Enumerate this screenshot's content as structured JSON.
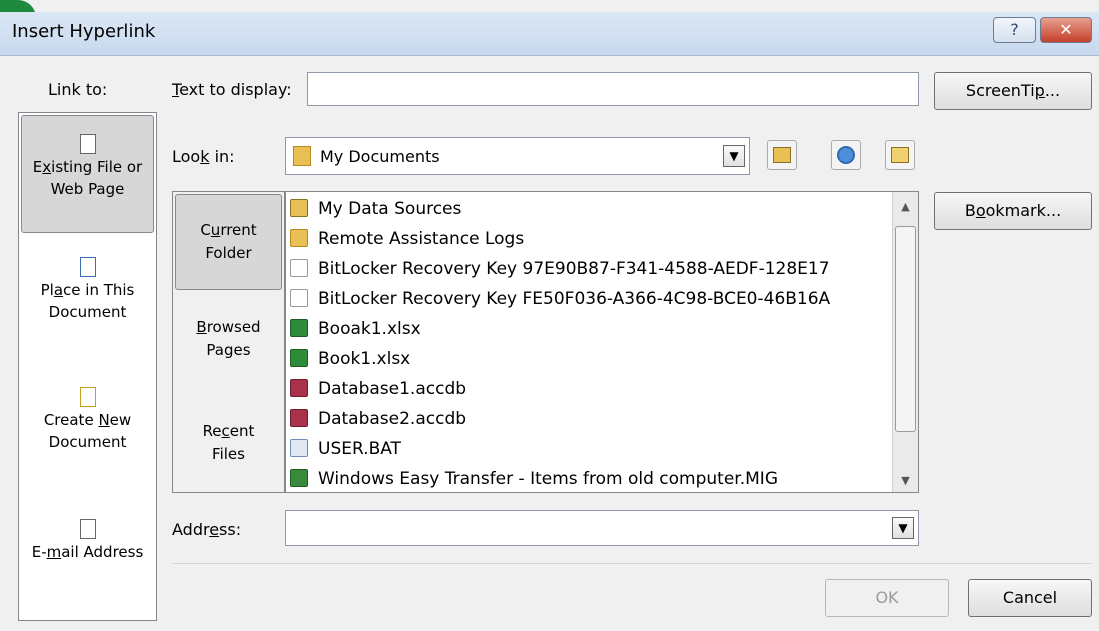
{
  "window": {
    "title": "Insert Hyperlink",
    "help_label": "?",
    "close_label": "✕"
  },
  "link_to": {
    "header": "Link to:",
    "items": [
      {
        "label_pre": "E",
        "label_u": "x",
        "label_post": "isting File or",
        "line2": "Web Page",
        "icon": "existing-file-icon"
      },
      {
        "label_pre": "Pl",
        "label_u": "a",
        "label_post": "ce in This",
        "line2": "Document",
        "icon": "place-in-document-icon"
      },
      {
        "label_pre": "Create ",
        "label_u": "N",
        "label_post": "ew",
        "line2": "Document",
        "icon": "create-new-document-icon"
      },
      {
        "label_pre": "E-",
        "label_u": "m",
        "label_post": "ail Address",
        "line2": "",
        "icon": "email-address-icon"
      }
    ]
  },
  "text_to_display": {
    "label_u": "T",
    "label_rest": "ext to display:",
    "value": ""
  },
  "screentip_button": {
    "pre": "ScreenTi",
    "u": "p",
    "post": "..."
  },
  "look_in": {
    "label_pre": "Loo",
    "label_u": "k",
    "label_post": " in:",
    "value": "My Documents"
  },
  "folder_nav": [
    {
      "line1_pre": "C",
      "line1_u": "u",
      "line1_post": "rrent",
      "line2": "Folder"
    },
    {
      "line1_pre": "",
      "line1_u": "B",
      "line1_post": "rowsed",
      "line2": "Pages"
    },
    {
      "line1_pre": "Re",
      "line1_u": "c",
      "line1_post": "ent",
      "line2": "Files"
    }
  ],
  "files": [
    {
      "name": "My Data Sources",
      "icon": "data-sources-folder-icon",
      "color": "#e8c056"
    },
    {
      "name": "Remote Assistance Logs",
      "icon": "folder-icon",
      "color": "#e8c056"
    },
    {
      "name": "BitLocker Recovery Key 97E90B87-F341-4588-AEDF-128E17",
      "icon": "text-file-icon",
      "color": "#ffffff"
    },
    {
      "name": "BitLocker Recovery Key FE50F036-A366-4C98-BCE0-46B16A",
      "icon": "text-file-icon",
      "color": "#ffffff"
    },
    {
      "name": "Booak1.xlsx",
      "icon": "excel-file-icon",
      "color": "#2e8b3a"
    },
    {
      "name": "Book1.xlsx",
      "icon": "excel-file-icon",
      "color": "#2e8b3a"
    },
    {
      "name": "Database1.accdb",
      "icon": "access-file-icon",
      "color": "#a8324a"
    },
    {
      "name": "Database2.accdb",
      "icon": "access-file-icon",
      "color": "#a8324a"
    },
    {
      "name": "USER.BAT",
      "icon": "batch-file-icon",
      "color": "#6a8fb8"
    },
    {
      "name": "Windows Easy Transfer - Items from old computer.MIG",
      "icon": "easy-transfer-icon",
      "color": "#3a8a3e"
    }
  ],
  "bookmark_button": {
    "pre": "B",
    "u": "o",
    "post": "okmark..."
  },
  "address": {
    "label_pre": "Addr",
    "label_u": "e",
    "label_post": "ss:",
    "value": ""
  },
  "ok_label": "OK",
  "cancel_label": "Cancel"
}
